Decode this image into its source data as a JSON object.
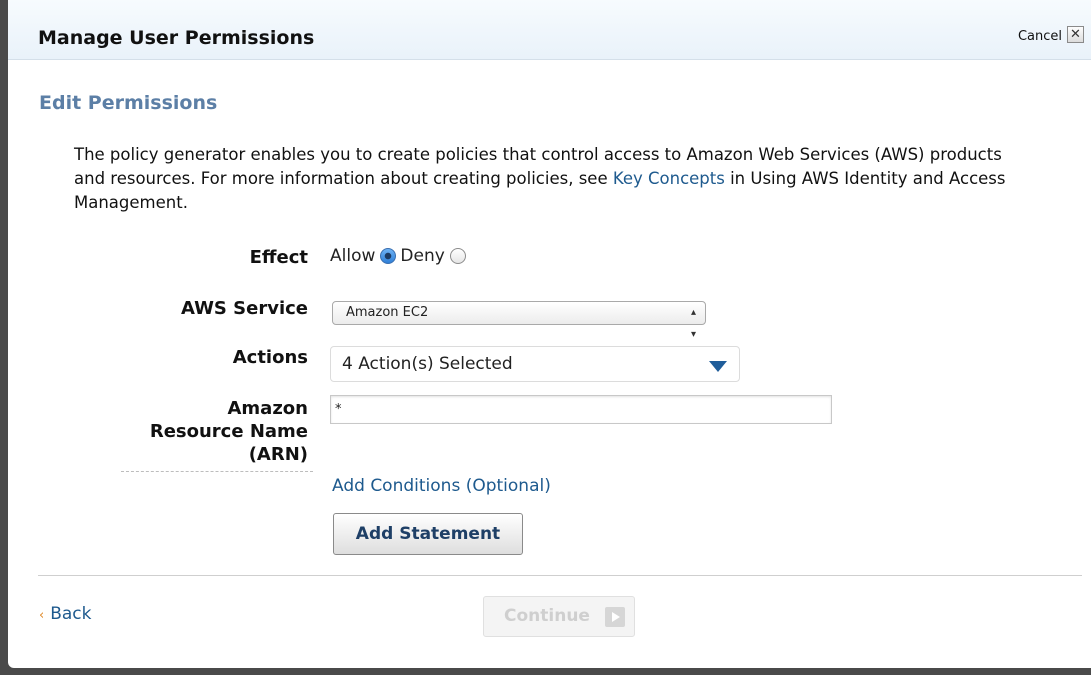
{
  "dialog": {
    "title": "Manage User Permissions",
    "cancel_label": "Cancel",
    "close_glyph": "✕"
  },
  "section": {
    "heading": "Edit Permissions",
    "description_pre": "The policy generator enables you to create policies that control access to Amazon Web Services (AWS) products and resources. For more information about creating policies, see ",
    "description_link": "Key Concepts",
    "description_post": " in Using AWS Identity and Access Management."
  },
  "form": {
    "effect_label": "Effect",
    "effect_allow": "Allow",
    "effect_deny": "Deny",
    "effect_selected": "Allow",
    "service_label": "AWS Service",
    "service_value": "Amazon EC2",
    "actions_label": "Actions",
    "actions_value": "4 Action(s) Selected",
    "arn_label_line1": "Amazon",
    "arn_label_line2": "Resource Name",
    "arn_label_line3": "(ARN)",
    "arn_value": "*",
    "add_conditions": "Add Conditions (Optional)",
    "add_statement": "Add Statement"
  },
  "footer": {
    "back_label": "Back",
    "continue_label": "Continue"
  },
  "colors": {
    "heading": "#5c7fa6",
    "link": "#1e5a8e",
    "back_chevron": "#e08a2a"
  }
}
